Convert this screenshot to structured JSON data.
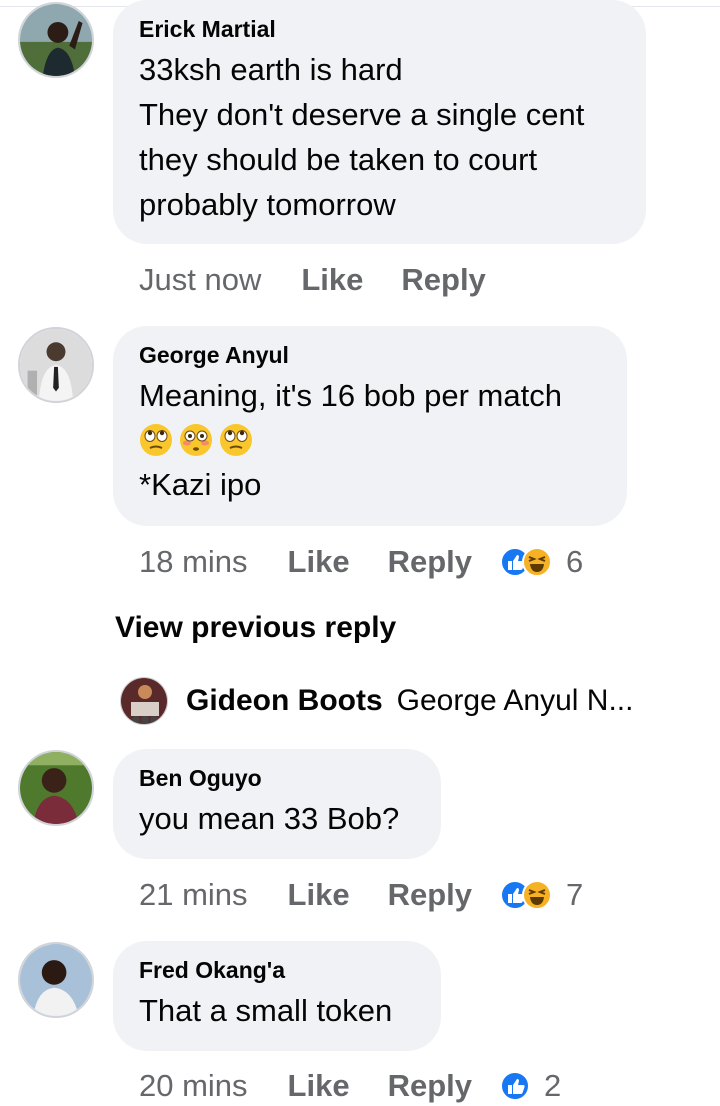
{
  "comments": [
    {
      "name": "Erick Martial",
      "lines": [
        "33ksh  earth is hard",
        "They don't deserve a single cent",
        "they should be taken to court",
        "probably tomorrow"
      ],
      "time": "Just now",
      "like": "Like",
      "reply": "Reply"
    },
    {
      "name": "George Anyul",
      "lines": [
        "Meaning, it's 16 bob per match",
        "*Kazi ipo"
      ],
      "emojis": [
        "face-with-rolling-eyes",
        "flushed-face",
        "face-with-rolling-eyes"
      ],
      "time": "18 mins",
      "like": "Like",
      "reply": "Reply",
      "reaction_count": "6"
    },
    {
      "name": "Ben Oguyo",
      "lines": [
        "you mean 33 Bob?"
      ],
      "time": "21 mins",
      "like": "Like",
      "reply": "Reply",
      "reaction_count": "7"
    },
    {
      "name": "Fred Okang'a",
      "lines": [
        "That a small token"
      ],
      "time": "20 mins",
      "like": "Like",
      "reply": "Reply",
      "reaction_count": "2"
    }
  ],
  "view_previous": "View previous reply",
  "collapsed_reply": {
    "name": "Gideon Boots",
    "text": "George Anyul  N..."
  },
  "colors": {
    "bubble": "#f0f2f5",
    "meta_text": "#65676b",
    "like_blue": "#1877f2",
    "haha_yellow": "#f7b125"
  }
}
